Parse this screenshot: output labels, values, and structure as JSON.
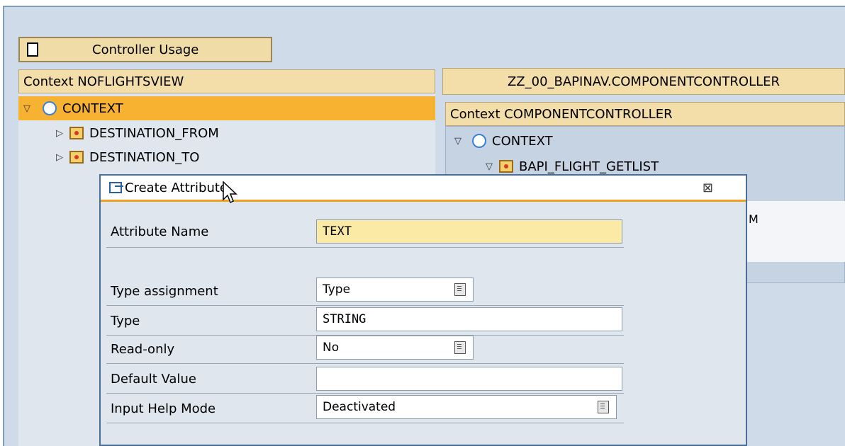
{
  "controller_usage": {
    "label": "Controller Usage"
  },
  "left_context": {
    "header": "Context NOFLIGHTSVIEW",
    "nodes": [
      {
        "label": "CONTEXT",
        "toggle": "▽"
      },
      {
        "label": "DESTINATION_FROM",
        "toggle": "▷"
      },
      {
        "label": "DESTINATION_TO",
        "toggle": "▷"
      }
    ]
  },
  "right_context": {
    "component_title": "ZZ_00_BAPINAV.COMPONENTCONTROLLER",
    "header": "Context COMPONENTCONTROLLER",
    "nodes": [
      {
        "label": "CONTEXT",
        "toggle": "▽"
      },
      {
        "label": "BAPI_FLIGHT_GETLIST",
        "toggle": "▽"
      }
    ],
    "partial_text": "M"
  },
  "dialog": {
    "title": "Create Attribute",
    "close_glyph": "⊠",
    "fields": {
      "attribute_name": {
        "label": "Attribute Name",
        "value": "TEXT"
      },
      "type_assignment": {
        "label": "Type assignment",
        "value": "Type"
      },
      "type": {
        "label": "Type",
        "value": "STRING"
      },
      "read_only": {
        "label": "Read-only",
        "value": "No"
      },
      "default_value": {
        "label": "Default Value",
        "value": ""
      },
      "input_help_mode": {
        "label": "Input Help Mode",
        "value": "Deactivated"
      }
    }
  },
  "colors": {
    "accent": "#f0a020",
    "selected": "#f8b231",
    "header": "#f3dda8",
    "background": "#cfdbe8"
  }
}
